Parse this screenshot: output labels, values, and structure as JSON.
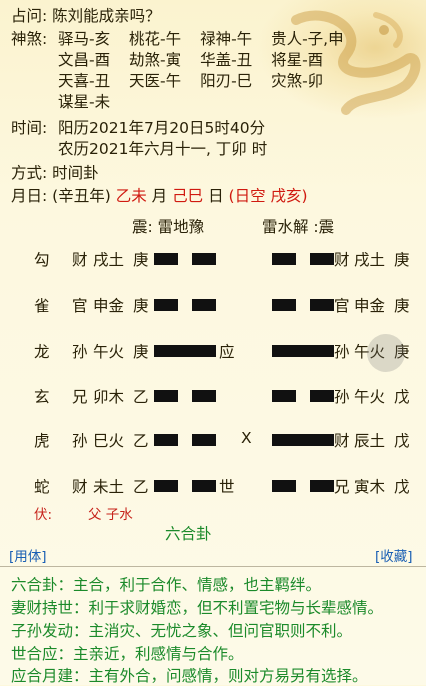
{
  "divination": {
    "label": "占问:",
    "value": "陈刘能成亲吗？"
  },
  "shensha": {
    "label": "神煞:",
    "lines": [
      [
        "驿马-亥",
        "桃花-午",
        "禄神-午",
        "贵人-子,申"
      ],
      [
        "文昌-酉",
        "劫煞-寅",
        "华盖-丑",
        "将星-酉"
      ],
      [
        "天喜-丑",
        "天医-午",
        "阳刃-巳",
        "灾煞-卯"
      ],
      [
        "谋星-未"
      ]
    ]
  },
  "time": {
    "label": "时间:",
    "solar": "阳历2021年7月20日5时40分",
    "lunar": "农历2021年六月十一, 丁卯 时"
  },
  "method": {
    "label": "方式:",
    "value": "时间卦"
  },
  "month_day": {
    "label": "月日:",
    "year": "(辛丑年)",
    "month_gz": "乙未",
    "month_char": "月",
    "day_gz": "己巳",
    "day_char": "日",
    "kongwang": "(日空 戌亥)"
  },
  "gua": {
    "main": "震: 雷地豫",
    "changed": "雷水解 :震",
    "yao": [
      {
        "god": "勾",
        "rel": "财",
        "branch": "戌土",
        "stem": "庚",
        "type": "yin",
        "mark": "",
        "moving": "",
        "c_type": "yin",
        "c_rel": "财",
        "c_branch": "戌土",
        "c_stem": "庚"
      },
      {
        "god": "雀",
        "rel": "官",
        "branch": "申金",
        "stem": "庚",
        "type": "yin",
        "mark": "",
        "moving": "",
        "c_type": "yin",
        "c_rel": "官",
        "c_branch": "申金",
        "c_stem": "庚"
      },
      {
        "god": "龙",
        "rel": "孙",
        "branch": "午火",
        "stem": "庚",
        "type": "yang",
        "mark": "应",
        "moving": "",
        "c_type": "yang",
        "c_rel": "孙",
        "c_branch": "午火",
        "c_stem": "庚"
      },
      {
        "god": "玄",
        "rel": "兄",
        "branch": "卯木",
        "stem": "乙",
        "type": "yin",
        "mark": "",
        "moving": "",
        "c_type": "yin",
        "c_rel": "孙",
        "c_branch": "午火",
        "c_stem": "戊"
      },
      {
        "god": "虎",
        "rel": "孙",
        "branch": "巳火",
        "stem": "乙",
        "type": "yin",
        "mark": "",
        "moving": "X",
        "c_type": "yang",
        "c_rel": "财",
        "c_branch": "辰土",
        "c_stem": "戊"
      },
      {
        "god": "蛇",
        "rel": "财",
        "branch": "未土",
        "stem": "乙",
        "type": "yin",
        "mark": "世",
        "moving": "",
        "c_type": "yin",
        "c_rel": "兄",
        "c_branch": "寅木",
        "c_stem": "戊"
      }
    ],
    "fushen_label": "伏:",
    "fushen_value": "父 子水",
    "relation": "六合卦"
  },
  "buttons": {
    "yongti": "[用体]",
    "favorite": "[收藏]"
  },
  "notes": [
    "六合卦：主合，利于合作、情感，也主羁绊。",
    "妻财持世：利于求财婚恋，但不利置宅物与长辈感情。",
    "子孙发动：主消灾、无忧之象、但问官职则不利。",
    "世合应：主亲近，利感情与合作。",
    "应合月建：主有外合，问感情，则对方易另有选择。"
  ],
  "colors": {
    "red": "#d01a10",
    "green": "#1b8a2a",
    "blue": "#1a5fb4",
    "bar": "#111111"
  }
}
